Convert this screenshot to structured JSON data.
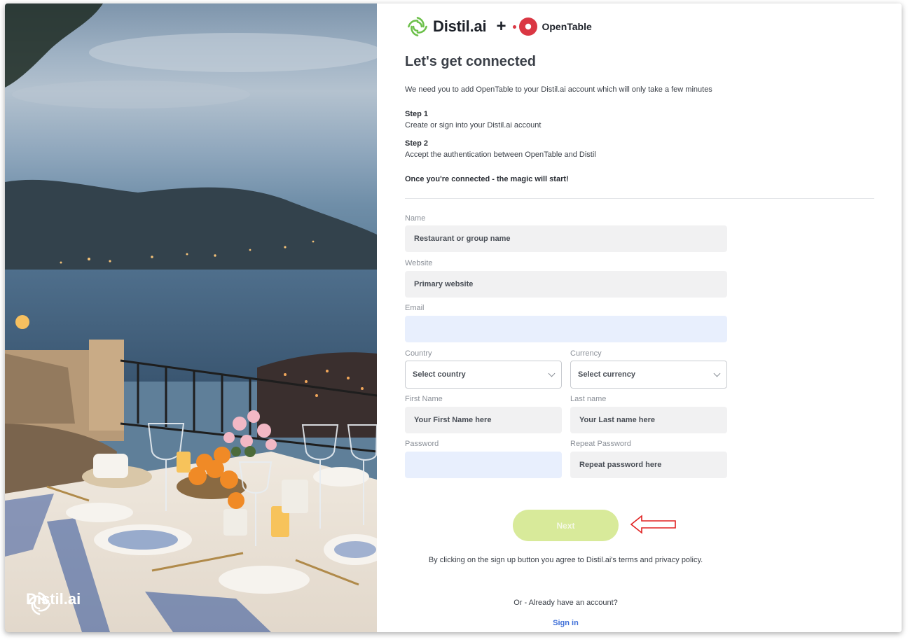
{
  "brand": {
    "distil_name": "Distil.ai",
    "plus": "+",
    "opentable_name": "OpenTable",
    "distil_green": "#6cc04a",
    "opentable_red": "#da3743",
    "photo_logo_text": "Distil.ai"
  },
  "header": {
    "title": "Let's get connected",
    "intro": "We need you to add OpenTable to your Distil.ai account which will only take a few minutes"
  },
  "steps": [
    {
      "heading": "Step 1",
      "text": "Create or sign into your Distil.ai account"
    },
    {
      "heading": "Step 2",
      "text": "Accept the authentication between OpenTable and Distil"
    }
  ],
  "magic": "Once you're connected - the magic will start!",
  "form": {
    "name": {
      "label": "Name",
      "placeholder": "Restaurant or group name"
    },
    "website": {
      "label": "Website",
      "placeholder": "Primary website"
    },
    "email": {
      "label": "Email",
      "value": ""
    },
    "country": {
      "label": "Country",
      "selected": "Select country"
    },
    "currency": {
      "label": "Currency",
      "selected": "Select currency"
    },
    "first_name": {
      "label": "First Name",
      "placeholder": "Your First Name here"
    },
    "last_name": {
      "label": "Last name",
      "placeholder": "Your Last name here"
    },
    "password": {
      "label": "Password",
      "value": ""
    },
    "repeat_password": {
      "label": "Repeat Password",
      "placeholder": "Repeat password here"
    },
    "next_label": "Next",
    "next_color": "#d8ea9a"
  },
  "footer": {
    "terms": "By clicking on the sign up button you agree to Distil.ai's terms and privacy policy.",
    "already": "Or - Already have an account?",
    "signin": "Sign in",
    "link_color": "#3f6fd8"
  },
  "annotation": {
    "arrow_color": "#e02020",
    "arrow_icon": "outline-left-arrow"
  }
}
